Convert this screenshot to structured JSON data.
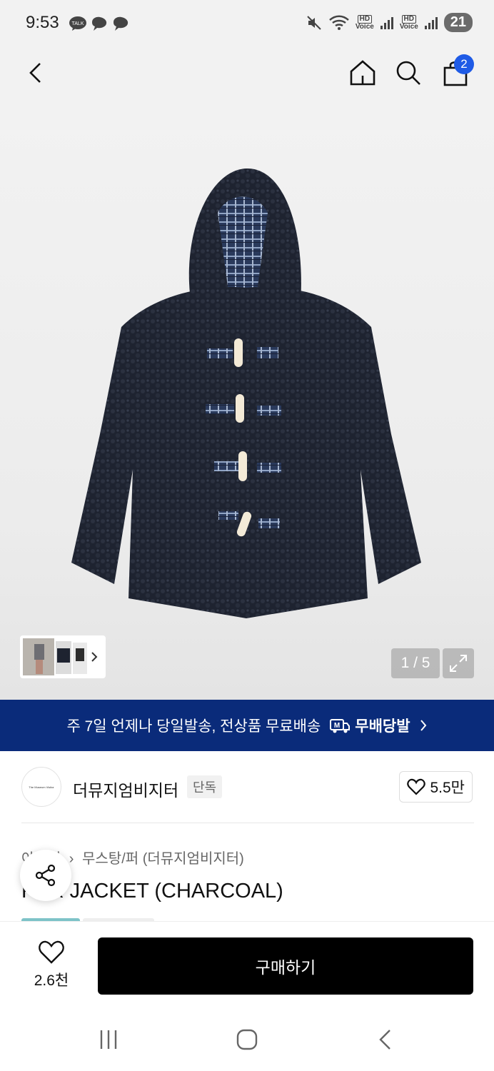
{
  "status_bar": {
    "time": "9:53",
    "battery": "21",
    "notif_talk": "TALK",
    "hd_label": "HD",
    "voice_label": "Voice"
  },
  "header": {
    "cart_count": "2"
  },
  "gallery": {
    "counter": "1 / 5"
  },
  "promo": {
    "text": "주 7일 언제나 당일발송, 전상품 무료배송",
    "brand": "무배당발",
    "brand_mark": "M"
  },
  "brand": {
    "name": "더뮤지엄비지터",
    "tag": "단독",
    "likes": "5.5만",
    "logo_text": "The Museum Visitor"
  },
  "product": {
    "breadcrumb_category": "아우터",
    "breadcrumb_sub": "무스탕/퍼 (더뮤지엄비지터)",
    "title": "FUR JACKET (CHARCOAL)"
  },
  "bottom": {
    "wish_count": "2.6천",
    "buy_label": "구매하기"
  },
  "colors": {
    "promo_bg": "#0a2b7a",
    "badge": "#1f5be6",
    "buy_bg": "#000000",
    "accent_chip": "#7ec3c8"
  }
}
